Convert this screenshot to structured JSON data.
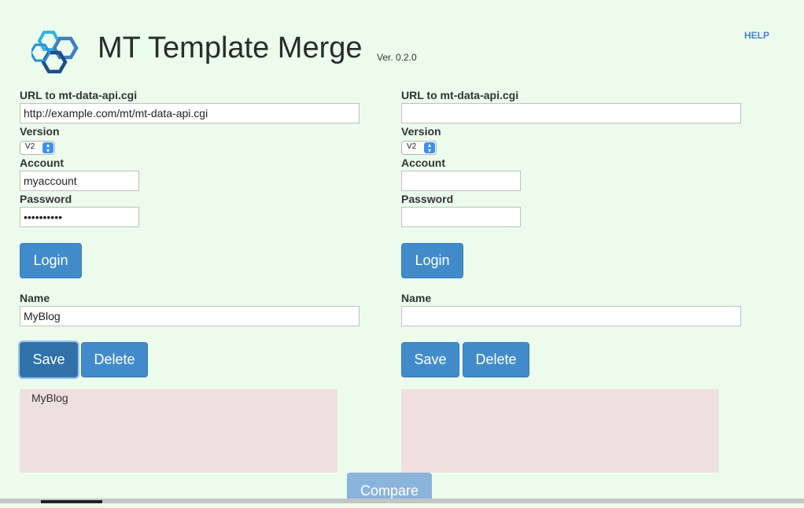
{
  "header": {
    "title": "MT Template Merge",
    "version": "Ver. 0.2.0",
    "help_label": "HELP"
  },
  "panels": [
    {
      "url_label": "URL to mt-data-api.cgi",
      "url_value": "http://example.com/mt/mt-data-api.cgi",
      "version_label": "Version",
      "version_value": "V2",
      "account_label": "Account",
      "account_value": "myaccount",
      "password_label": "Password",
      "password_value": "••••••••••",
      "login_label": "Login",
      "name_label": "Name",
      "name_value": "MyBlog",
      "save_label": "Save",
      "delete_label": "Delete",
      "list_items": [
        "MyBlog"
      ]
    },
    {
      "url_label": "URL to mt-data-api.cgi",
      "url_value": "",
      "version_label": "Version",
      "version_value": "V2",
      "account_label": "Account",
      "account_value": "",
      "password_label": "Password",
      "password_value": "",
      "login_label": "Login",
      "name_label": "Name",
      "name_value": "",
      "save_label": "Save",
      "delete_label": "Delete",
      "list_items": []
    }
  ],
  "compare_label": "Compare",
  "colors": {
    "background": "#ebfbec",
    "button": "#428bca",
    "list_background": "#f0dfdf",
    "help_link": "#4a86c5"
  }
}
